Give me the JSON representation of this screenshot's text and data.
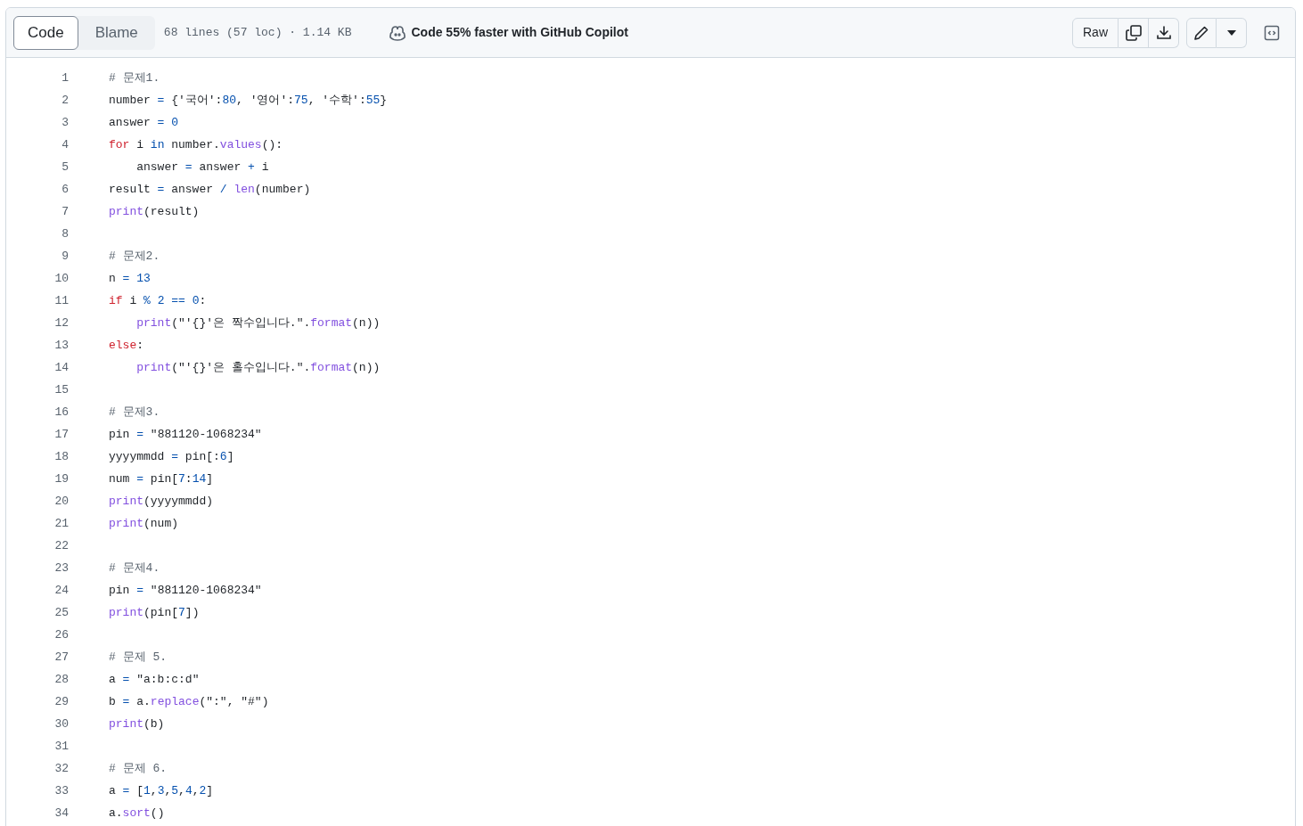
{
  "view_tabs": [
    {
      "label": "Code",
      "selected": true
    },
    {
      "label": "Blame",
      "selected": false
    }
  ],
  "file_info": "68 lines (57 loc) · 1.14 KB",
  "copilot_promo": "Code 55% faster with GitHub Copilot",
  "raw_button": "Raw",
  "lines": [
    {
      "number": "1",
      "tokens": [
        {
          "text": "# 문제1.",
          "kind": "comment"
        }
      ]
    },
    {
      "number": "2",
      "tokens": [
        {
          "text": "number ",
          "kind": "plain"
        },
        {
          "text": "= ",
          "kind": "operator"
        },
        {
          "text": "{'국어':",
          "kind": "plain"
        },
        {
          "text": "80",
          "kind": "number"
        },
        {
          "text": ", '영어':",
          "kind": "plain"
        },
        {
          "text": "75",
          "kind": "number"
        },
        {
          "text": ", '수학':",
          "kind": "plain"
        },
        {
          "text": "55",
          "kind": "number"
        },
        {
          "text": "}",
          "kind": "plain"
        }
      ]
    },
    {
      "number": "3",
      "tokens": [
        {
          "text": "answer ",
          "kind": "plain"
        },
        {
          "text": "= ",
          "kind": "operator"
        },
        {
          "text": "0",
          "kind": "number"
        }
      ]
    },
    {
      "number": "4",
      "tokens": [
        {
          "text": "for ",
          "kind": "keyword"
        },
        {
          "text": "i ",
          "kind": "plain"
        },
        {
          "text": "in ",
          "kind": "operator"
        },
        {
          "text": "number.",
          "kind": "plain"
        },
        {
          "text": "values",
          "kind": "method"
        },
        {
          "text": "():",
          "kind": "plain"
        }
      ]
    },
    {
      "number": "5",
      "tokens": [
        {
          "text": "    answer ",
          "kind": "plain"
        },
        {
          "text": "= ",
          "kind": "operator"
        },
        {
          "text": "answer ",
          "kind": "plain"
        },
        {
          "text": "+ ",
          "kind": "operator"
        },
        {
          "text": "i",
          "kind": "plain"
        }
      ]
    },
    {
      "number": "6",
      "tokens": [
        {
          "text": "result ",
          "kind": "plain"
        },
        {
          "text": "= ",
          "kind": "operator"
        },
        {
          "text": "answer ",
          "kind": "plain"
        },
        {
          "text": "/ ",
          "kind": "operator"
        },
        {
          "text": "len",
          "kind": "builtin"
        },
        {
          "text": "(number)",
          "kind": "plain"
        }
      ]
    },
    {
      "number": "7",
      "tokens": [
        {
          "text": "print",
          "kind": "builtin"
        },
        {
          "text": "(result)",
          "kind": "plain"
        }
      ]
    },
    {
      "number": "8"
    },
    {
      "number": "9",
      "tokens": [
        {
          "text": "# 문제2.",
          "kind": "comment"
        }
      ]
    },
    {
      "number": "10",
      "tokens": [
        {
          "text": "n ",
          "kind": "plain"
        },
        {
          "text": "= ",
          "kind": "operator"
        },
        {
          "text": "13",
          "kind": "number"
        }
      ]
    },
    {
      "number": "11",
      "tokens": [
        {
          "text": "if ",
          "kind": "keyword"
        },
        {
          "text": "i ",
          "kind": "plain"
        },
        {
          "text": "% ",
          "kind": "operator"
        },
        {
          "text": "2 ",
          "kind": "number"
        },
        {
          "text": "== ",
          "kind": "operator"
        },
        {
          "text": "0",
          "kind": "number"
        },
        {
          "text": ":",
          "kind": "plain"
        }
      ]
    },
    {
      "number": "12",
      "tokens": [
        {
          "text": "    print",
          "kind": "builtin"
        },
        {
          "text": "(\"'{}'은 짝수입니다.\".",
          "kind": "plain"
        },
        {
          "text": "format",
          "kind": "method"
        },
        {
          "text": "(n))",
          "kind": "plain"
        }
      ]
    },
    {
      "number": "13",
      "tokens": [
        {
          "text": "else",
          "kind": "keyword"
        },
        {
          "text": ":",
          "kind": "plain"
        }
      ]
    },
    {
      "number": "14",
      "tokens": [
        {
          "text": "    print",
          "kind": "builtin"
        },
        {
          "text": "(\"'{}'은 홀수입니다.\".",
          "kind": "plain"
        },
        {
          "text": "format",
          "kind": "method"
        },
        {
          "text": "(n))",
          "kind": "plain"
        }
      ]
    },
    {
      "number": "15"
    },
    {
      "number": "16",
      "tokens": [
        {
          "text": "# 문제3.",
          "kind": "comment"
        }
      ]
    },
    {
      "number": "17",
      "tokens": [
        {
          "text": "pin ",
          "kind": "plain"
        },
        {
          "text": "= ",
          "kind": "operator"
        },
        {
          "text": "\"881120-1068234\"",
          "kind": "plain"
        }
      ]
    },
    {
      "number": "18",
      "tokens": [
        {
          "text": "yyyymmdd ",
          "kind": "plain"
        },
        {
          "text": "= ",
          "kind": "operator"
        },
        {
          "text": "pin[:",
          "kind": "plain"
        },
        {
          "text": "6",
          "kind": "number"
        },
        {
          "text": "]",
          "kind": "plain"
        }
      ]
    },
    {
      "number": "19",
      "tokens": [
        {
          "text": "num ",
          "kind": "plain"
        },
        {
          "text": "= ",
          "kind": "operator"
        },
        {
          "text": "pin[",
          "kind": "plain"
        },
        {
          "text": "7",
          "kind": "number"
        },
        {
          "text": ":",
          "kind": "plain"
        },
        {
          "text": "14",
          "kind": "number"
        },
        {
          "text": "]",
          "kind": "plain"
        }
      ]
    },
    {
      "number": "20",
      "tokens": [
        {
          "text": "print",
          "kind": "builtin"
        },
        {
          "text": "(yyyymmdd)",
          "kind": "plain"
        }
      ]
    },
    {
      "number": "21",
      "tokens": [
        {
          "text": "print",
          "kind": "builtin"
        },
        {
          "text": "(num)",
          "kind": "plain"
        }
      ]
    },
    {
      "number": "22"
    },
    {
      "number": "23",
      "tokens": [
        {
          "text": "# 문제4.",
          "kind": "comment"
        }
      ]
    },
    {
      "number": "24",
      "tokens": [
        {
          "text": "pin ",
          "kind": "plain"
        },
        {
          "text": "= ",
          "kind": "operator"
        },
        {
          "text": "\"881120-1068234\"",
          "kind": "plain"
        }
      ]
    },
    {
      "number": "25",
      "tokens": [
        {
          "text": "print",
          "kind": "builtin"
        },
        {
          "text": "(pin[",
          "kind": "plain"
        },
        {
          "text": "7",
          "kind": "number"
        },
        {
          "text": "])",
          "kind": "plain"
        }
      ]
    },
    {
      "number": "26"
    },
    {
      "number": "27",
      "tokens": [
        {
          "text": "# 문제 5.",
          "kind": "comment"
        }
      ]
    },
    {
      "number": "28",
      "tokens": [
        {
          "text": "a ",
          "kind": "plain"
        },
        {
          "text": "= ",
          "kind": "operator"
        },
        {
          "text": "\"a:b:c:d\"",
          "kind": "plain"
        }
      ]
    },
    {
      "number": "29",
      "tokens": [
        {
          "text": "b ",
          "kind": "plain"
        },
        {
          "text": "= ",
          "kind": "operator"
        },
        {
          "text": "a.",
          "kind": "plain"
        },
        {
          "text": "replace",
          "kind": "method"
        },
        {
          "text": "(\":\", \"#\")",
          "kind": "plain"
        }
      ]
    },
    {
      "number": "30",
      "tokens": [
        {
          "text": "print",
          "kind": "builtin"
        },
        {
          "text": "(b)",
          "kind": "plain"
        }
      ]
    },
    {
      "number": "31"
    },
    {
      "number": "32",
      "tokens": [
        {
          "text": "# 문제 6.",
          "kind": "comment"
        }
      ]
    },
    {
      "number": "33",
      "tokens": [
        {
          "text": "a ",
          "kind": "plain"
        },
        {
          "text": "= ",
          "kind": "operator"
        },
        {
          "text": "[",
          "kind": "plain"
        },
        {
          "text": "1",
          "kind": "number"
        },
        {
          "text": ",",
          "kind": "plain"
        },
        {
          "text": "3",
          "kind": "number"
        },
        {
          "text": ",",
          "kind": "plain"
        },
        {
          "text": "5",
          "kind": "number"
        },
        {
          "text": ",",
          "kind": "plain"
        },
        {
          "text": "4",
          "kind": "number"
        },
        {
          "text": ",",
          "kind": "plain"
        },
        {
          "text": "2",
          "kind": "number"
        },
        {
          "text": "]",
          "kind": "plain"
        }
      ]
    },
    {
      "number": "34",
      "tokens": [
        {
          "text": "a.",
          "kind": "plain"
        },
        {
          "text": "sort",
          "kind": "method"
        },
        {
          "text": "()",
          "kind": "plain"
        }
      ]
    }
  ]
}
